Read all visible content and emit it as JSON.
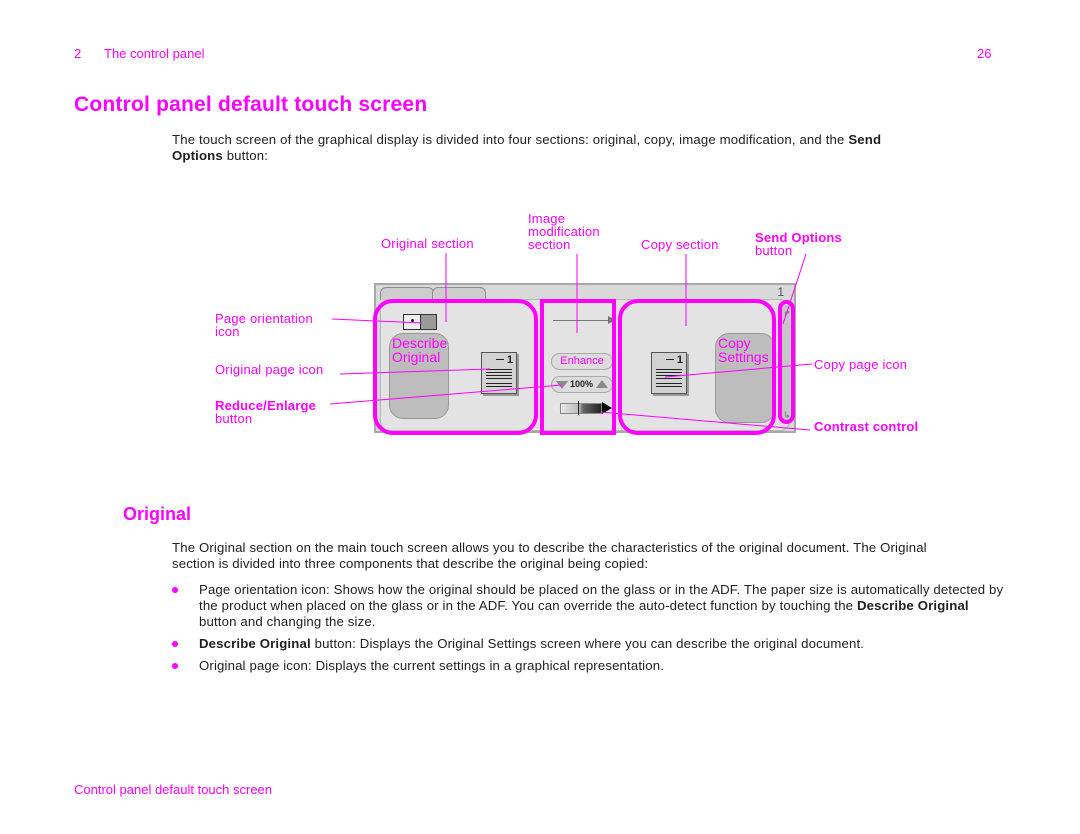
{
  "header": {
    "chapter_number": "2",
    "chapter_title": "The control panel",
    "page_number": "26"
  },
  "title": "Control panel default touch screen",
  "intro": {
    "text_before": "The touch screen of the graphical display is divided into four sections: original, copy, image modification, and the ",
    "bold": "Send Options",
    "text_after": " button:"
  },
  "figure": {
    "callouts": {
      "original_section": "Original section",
      "image_modification_section": [
        "Image",
        "modification",
        "section"
      ],
      "copy_section": "Copy section",
      "send_options_bold": "Send Options",
      "send_options_rest": "button",
      "page_orientation": [
        "Page orientation",
        "icon"
      ],
      "original_page_icon": "Original page icon",
      "reduce_enlarge_bold": "Reduce/Enlarge",
      "reduce_enlarge_rest": "button",
      "copy_page_icon": "Copy page icon",
      "contrast_control": "Contrast control"
    },
    "screen": {
      "page_indicator": "1",
      "describe_original": [
        "Describe",
        "Original"
      ],
      "copy_settings": [
        "Copy",
        "Settings"
      ],
      "enhance": "Enhance",
      "zoom_value": "100%",
      "page_icon_number": "1"
    },
    "colors": {
      "highlight": "#ff00ff",
      "screen_bg": "#d9d9d9",
      "button_gray": "#bdbdbd"
    }
  },
  "section_original": {
    "heading": "Original",
    "paragraph": "The Original section on the main touch screen allows you to describe the characteristics of the original document. The Original section is divided into three components that describe the original being copied:",
    "bullets": [
      {
        "bold": "",
        "text": "Page orientation icon: Shows how the original should be placed on the glass or in the ADF. The paper size is automatically detected by the product when placed on the glass or in the ADF. You can override the auto-detect function by touching the ",
        "bold2": "Describe Original",
        "text2": " button and changing the size."
      },
      {
        "bold": "Describe Original",
        "text": " button: Displays the Original Settings screen where you can describe the original document.",
        "bold2": "",
        "text2": ""
      },
      {
        "bold": "",
        "text": "Original page icon: Displays the current settings in a graphical representation.",
        "bold2": "",
        "text2": ""
      }
    ]
  },
  "footer": {
    "text": "Control panel default touch screen"
  }
}
